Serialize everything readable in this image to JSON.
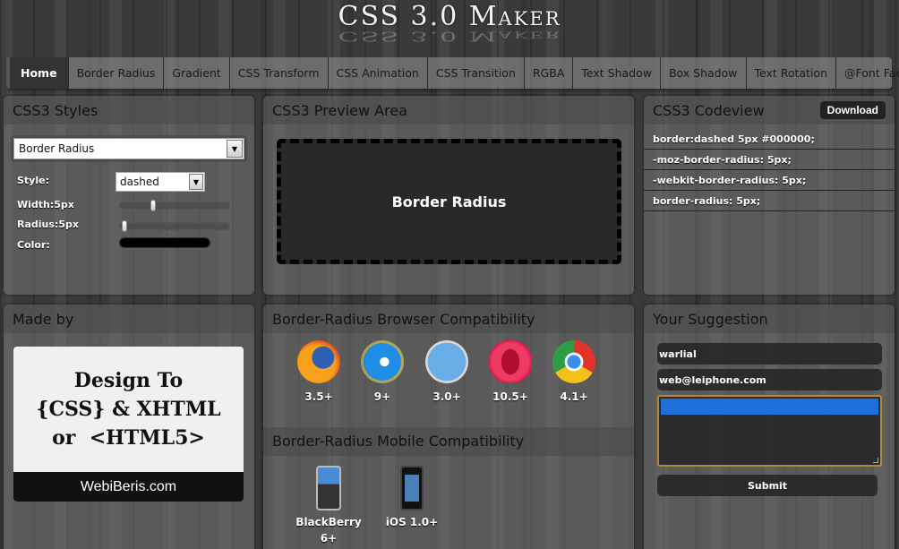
{
  "app": {
    "title": "CSS 3.0 Maker"
  },
  "nav": {
    "items": [
      {
        "label": "Home",
        "active": true
      },
      {
        "label": "Border Radius"
      },
      {
        "label": "Gradient"
      },
      {
        "label": "CSS Transform"
      },
      {
        "label": "CSS Animation"
      },
      {
        "label": "CSS Transition"
      },
      {
        "label": "RGBA"
      },
      {
        "label": "Text Shadow"
      },
      {
        "label": "Box Shadow"
      },
      {
        "label": "Text Rotation"
      },
      {
        "label": "@Font Face"
      }
    ]
  },
  "styles_panel": {
    "title": "CSS3 Styles",
    "property_select": "Border Radius",
    "style_label": "Style:",
    "style_value": "dashed",
    "width_label": "Width:5px",
    "width_value_fraction": 0.3,
    "radius_label": "Radius:5px",
    "radius_value_fraction": 0.02,
    "color_label": "Color:",
    "color_value": "#000000"
  },
  "preview_panel": {
    "title": "CSS3 Preview Area",
    "preview_text": "Border Radius"
  },
  "code_panel": {
    "title": "CSS3 Codeview",
    "download_label": "Download",
    "lines": [
      "border:dashed 5px #000000;",
      "-moz-border-radius: 5px;",
      "-webkit-border-radius: 5px;",
      "border-radius: 5px;"
    ]
  },
  "made_panel": {
    "title": "Made by",
    "card_lines": [
      "Design To",
      "{CSS} & XHTML",
      "or  <HTML5>"
    ],
    "card_footer": "WebiBeris.com"
  },
  "compat_panel": {
    "title": "Border-Radius Browser Compatibility",
    "browsers": [
      {
        "name": "firefox-icon",
        "version": "3.5+"
      },
      {
        "name": "ie-icon",
        "version": "9+"
      },
      {
        "name": "safari-icon",
        "version": "3.0+"
      },
      {
        "name": "opera-icon",
        "version": "10.5+"
      },
      {
        "name": "chrome-icon",
        "version": "4.1+"
      }
    ],
    "mobile_title": "Border-Radius Mobile Compatibility",
    "mobile": [
      {
        "name": "blackberry-icon",
        "label_line1": "BlackBerry",
        "label_line2": "6+"
      },
      {
        "name": "iphone-icon",
        "label_line1": "iOS 1.0+",
        "label_line2": ""
      }
    ]
  },
  "suggest_panel": {
    "title": "Your Suggestion",
    "name_value": "warlial",
    "email_value": "web@leiphone.com",
    "message_value": "",
    "submit_label": "Submit"
  }
}
